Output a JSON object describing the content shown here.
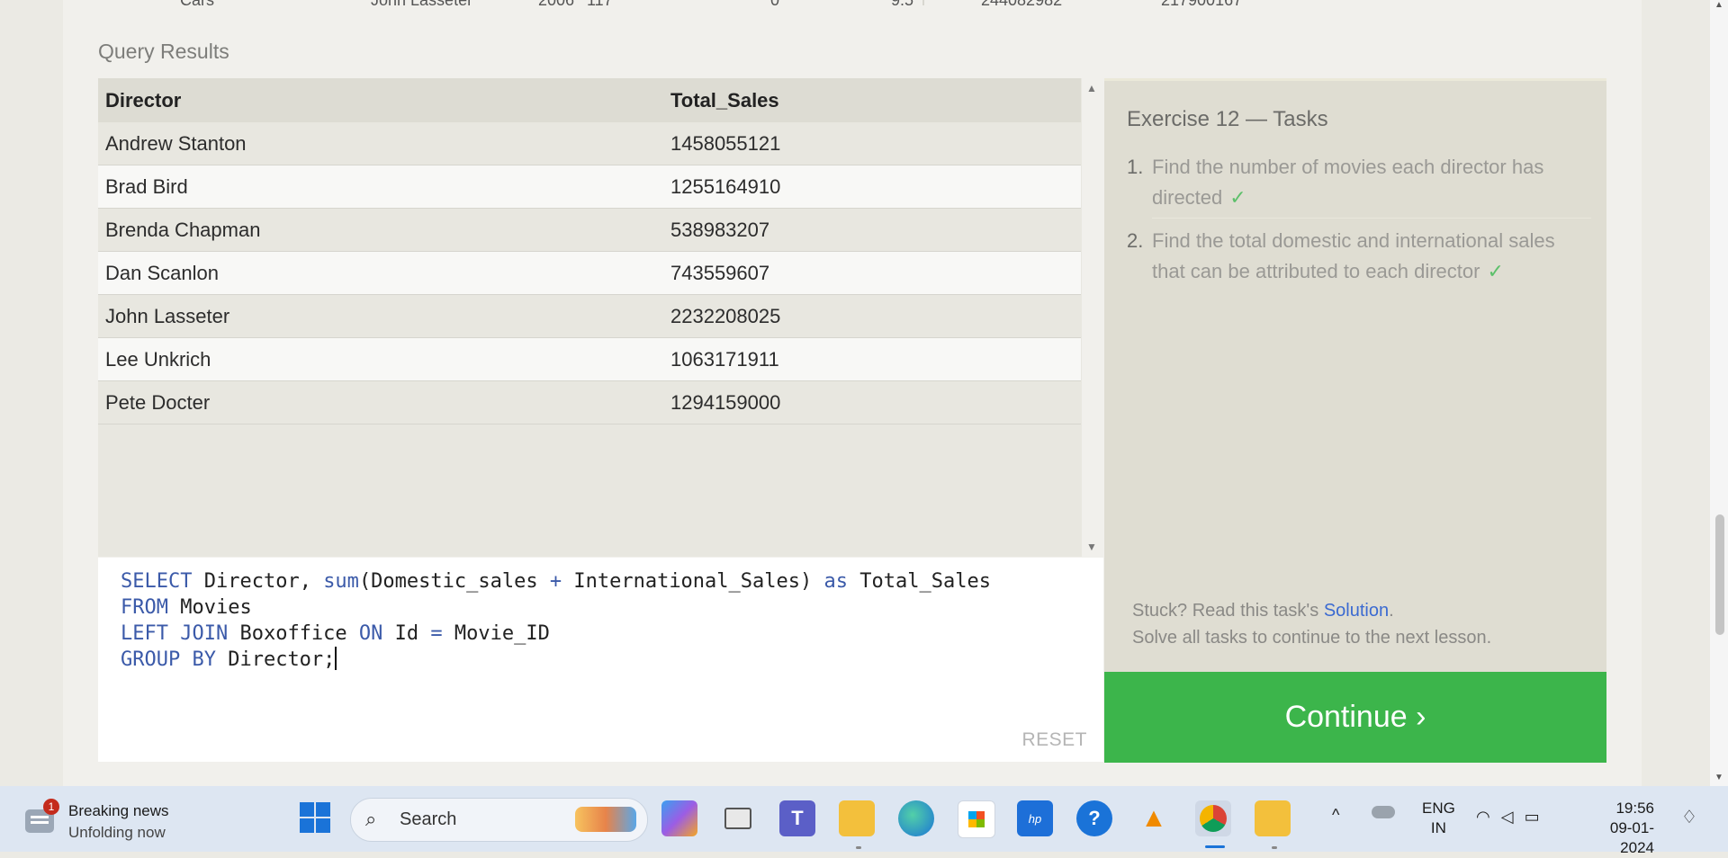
{
  "previous_table_partial": [
    "Cars",
    "John Lasseter",
    "2006",
    "117",
    "0",
    "9.5",
    "244082982",
    "217900167"
  ],
  "query_results": {
    "title": "Query Results",
    "columns": [
      "Director",
      "Total_Sales"
    ],
    "rows": [
      {
        "director": "Andrew Stanton",
        "total_sales": "1458055121"
      },
      {
        "director": "Brad Bird",
        "total_sales": "1255164910"
      },
      {
        "director": "Brenda Chapman",
        "total_sales": "538983207"
      },
      {
        "director": "Dan Scanlon",
        "total_sales": "743559607"
      },
      {
        "director": "John Lasseter",
        "total_sales": "2232208025"
      },
      {
        "director": "Lee Unkrich",
        "total_sales": "1063171911"
      },
      {
        "director": "Pete Docter",
        "total_sales": "1294159000"
      }
    ]
  },
  "editor": {
    "lines": [
      {
        "k1": "SELECT",
        "t1": " Director, ",
        "fn": "sum",
        "t2": "(Domestic_sales ",
        "op": "+",
        "t3": " International_Sales) ",
        "k2": "as",
        "t4": " Total_Sales"
      },
      {
        "k1": "FROM",
        "t1": " Movies"
      },
      {
        "k1": "LEFT JOIN",
        "t1": " Boxoffice ",
        "k2": "ON",
        "t2": " Id ",
        "op": "=",
        "t3": " Movie_ID"
      },
      {
        "k1": "GROUP BY",
        "t1": " Director;"
      }
    ],
    "reset_label": "RESET"
  },
  "tasks": {
    "title": "Exercise 12 — Tasks",
    "items": [
      {
        "num": "1.",
        "text": "Find the number of movies each director has directed",
        "check": "✓"
      },
      {
        "num": "2.",
        "text": "Find the total domestic and international sales that can be attributed to each director",
        "check": "✓"
      }
    ],
    "stuck_prefix": "Stuck? Read this task's ",
    "solution_link": "Solution",
    "stuck_suffix": ".",
    "hint": "Solve all tasks to continue to the next lesson."
  },
  "continue_label": "Continue ›",
  "taskbar": {
    "news_badge": "1",
    "news_title": "Breaking news",
    "news_subtitle": "Unfolding now",
    "search_label": "Search",
    "lang_top": "ENG",
    "lang_bottom": "IN",
    "time": "19:56",
    "date": "09-01-2024",
    "apps": [
      "copilot-icon",
      "task-view-icon",
      "teams-icon",
      "file-explorer-icon",
      "edge-icon",
      "store-icon",
      "myhp-icon",
      "help-icon",
      "vlc-icon",
      "chrome-icon",
      "onedrive-folder-icon"
    ]
  },
  "colors": {
    "continue": "#3cb54b",
    "keyword": "#3b5aa9",
    "link": "#3b6ad1",
    "check": "#5dc06b"
  }
}
